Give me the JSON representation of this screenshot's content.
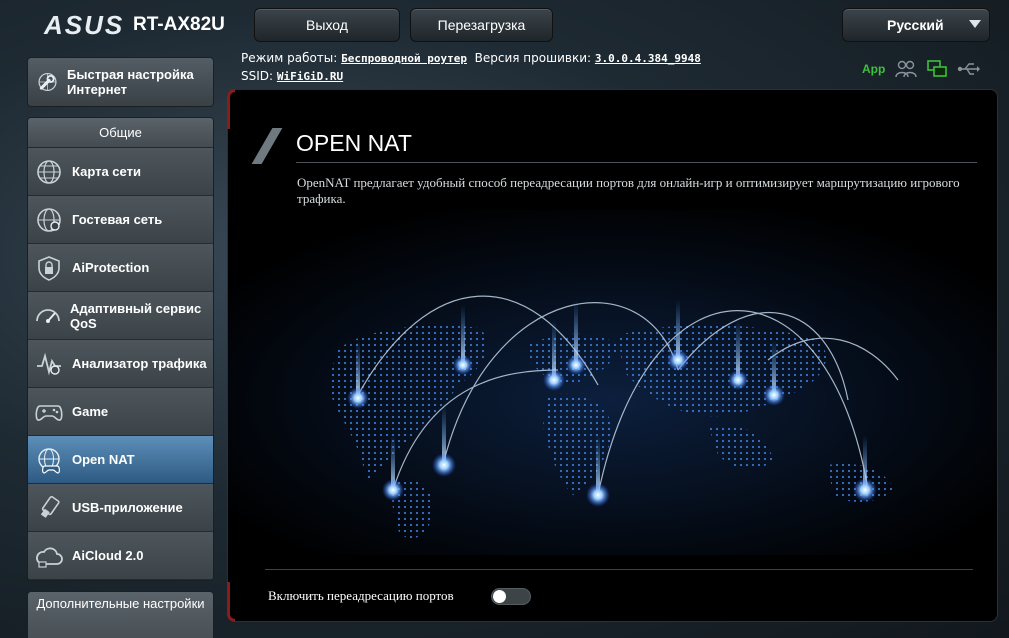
{
  "header": {
    "brand": "ASUS",
    "model": "RT-AX82U",
    "logout_label": "Выход",
    "reboot_label": "Перезагрузка",
    "language": "Русский"
  },
  "info": {
    "mode_label": "Режим работы:",
    "mode_value": "Беспроводной роутер",
    "firmware_label": "Версия прошивки:",
    "firmware_value": "3.0.0.4.384_9948",
    "ssid_label": "SSID:",
    "ssid_value": "WiFiGiD.RU",
    "app_label": "App"
  },
  "sidebar": {
    "quick_setup": "Быстрая настройка Интернет",
    "general_header": "Общие",
    "items": [
      {
        "label": "Карта сети",
        "icon": "globe-icon"
      },
      {
        "label": "Гостевая сеть",
        "icon": "guest-globe-icon"
      },
      {
        "label": "AiProtection",
        "icon": "shield-lock-icon"
      },
      {
        "label": "Адаптивный сервис QoS",
        "icon": "speedometer-icon"
      },
      {
        "label": "Анализатор трафика",
        "icon": "traffic-analyzer-icon"
      },
      {
        "label": "Game",
        "icon": "gamepad-icon"
      },
      {
        "label": "Open NAT",
        "icon": "gamepad-globe-icon",
        "active": true
      },
      {
        "label": "USB-приложение",
        "icon": "usb-icon"
      },
      {
        "label": "AiCloud 2.0",
        "icon": "cloud-icon"
      }
    ],
    "advanced_header": "Дополнительные настройки"
  },
  "main": {
    "title": "OPEN NAT",
    "description": "OpenNAT предлагает удобный способ переадресации портов для онлайн-игр и оптимизирует маршрутизацию игрового трафика.",
    "toggle_label": "Включить переадресацию портов",
    "toggle_on": false
  },
  "colors": {
    "active_item": "#3c6d96",
    "accent_red": "#8a1c1c",
    "app_green": "#3fbf3f",
    "world_glow": "#4a9cff"
  }
}
